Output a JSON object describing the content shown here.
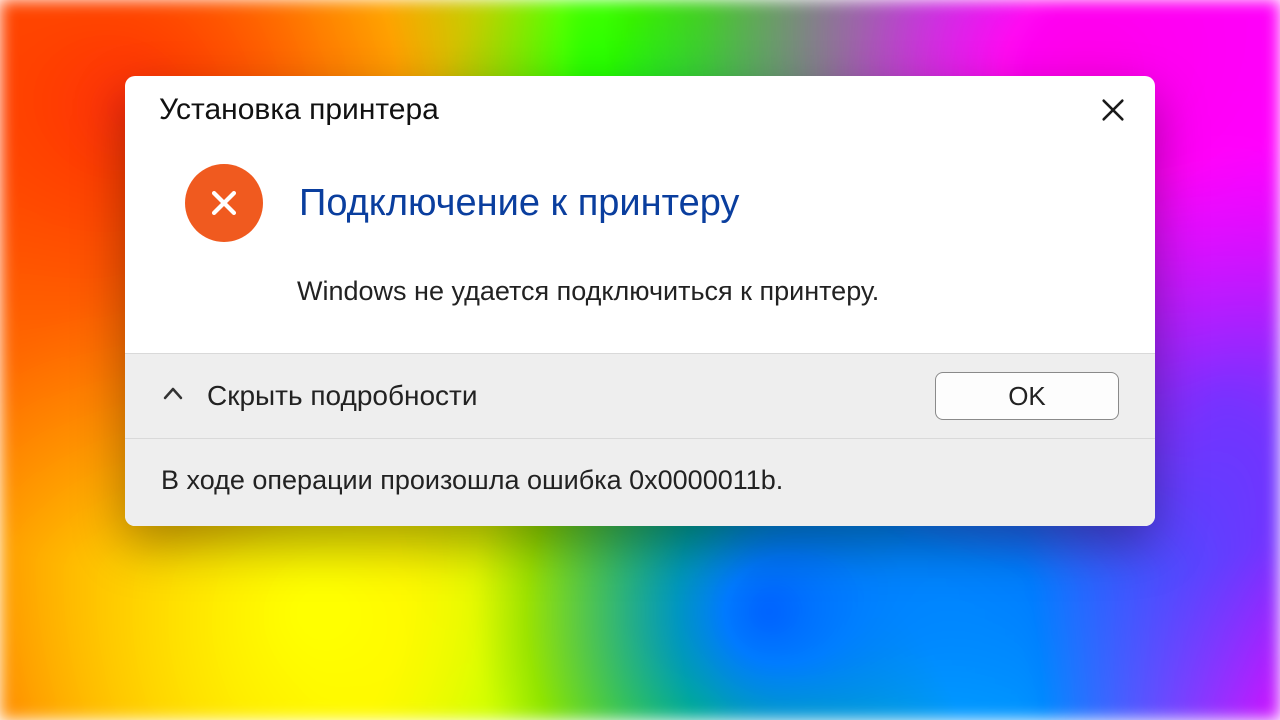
{
  "dialog": {
    "title": "Установка принтера",
    "heading": "Подключение к принтеру",
    "message": "Windows не удается подключиться к принтеру.",
    "toggle_label": "Скрыть подробности",
    "ok_label": "OK",
    "details_text": "В ходе операции произошла ошибка 0x0000011b."
  },
  "colors": {
    "heading": "#0a3e9e",
    "error_badge": "#f05a1f"
  }
}
